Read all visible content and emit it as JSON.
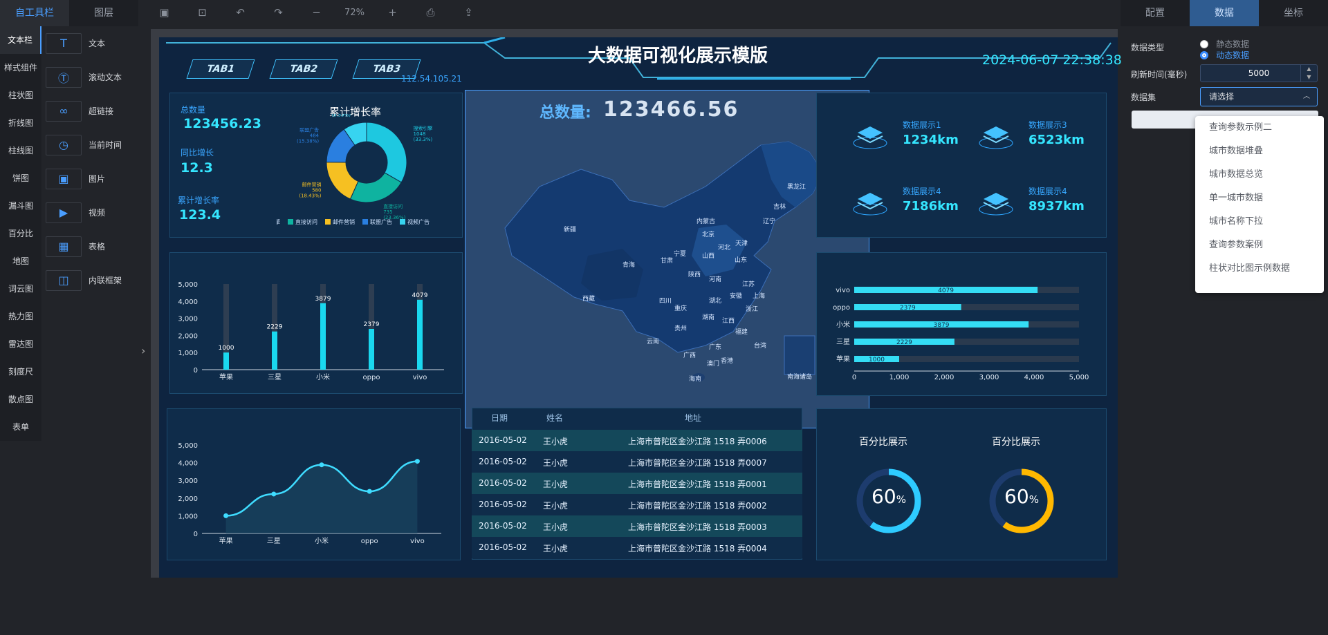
{
  "left_panel": {
    "tabs": [
      "自工具栏",
      "图层"
    ],
    "categories": [
      "文本栏",
      "样式组件",
      "柱状图",
      "折线图",
      "柱线图",
      "饼图",
      "漏斗图",
      "百分比",
      "地图",
      "词云图",
      "热力图",
      "雷达图",
      "刻度尺",
      "散点图",
      "表单"
    ],
    "components": [
      {
        "icon": "text-icon",
        "label": "文本"
      },
      {
        "icon": "scroll-text-icon",
        "label": "滚动文本"
      },
      {
        "icon": "link-icon",
        "label": "超链接"
      },
      {
        "icon": "clock-icon",
        "label": "当前时间"
      },
      {
        "icon": "image-icon",
        "label": "图片"
      },
      {
        "icon": "video-icon",
        "label": "视频"
      },
      {
        "icon": "table-icon",
        "label": "表格"
      },
      {
        "icon": "iframe-icon",
        "label": "内联框架"
      }
    ]
  },
  "toolbar": {
    "zoom": "72%"
  },
  "right_panel": {
    "tabs": [
      "配置",
      "数据",
      "坐标"
    ],
    "data_type_label": "数据类型",
    "data_type_options": [
      "静态数据",
      "动态数据"
    ],
    "refresh_label": "刷新时间(毫秒)",
    "refresh_value": "5000",
    "dataset_label": "数据集",
    "dataset_placeholder": "请选择",
    "dataset_options": [
      "查询参数示例二",
      "城市数据堆叠",
      "城市数据总览",
      "单一城市数据",
      "城市名称下拉",
      "查询参数案例",
      "柱状对比图示例数据"
    ]
  },
  "dashboard": {
    "title": "大数据可视化展示模版",
    "tabs": [
      "TAB1",
      "TAB2",
      "TAB3"
    ],
    "datetime": "2024-06-07 22:38:38",
    "ip": "112.54.105.21",
    "kpis": [
      {
        "label": "总数量",
        "value": "123456.23"
      },
      {
        "label": "同比增长",
        "value": "12.3"
      },
      {
        "label": "累计增长率",
        "value": "123.4"
      }
    ],
    "total_label": "总数量:",
    "total_value": "123466.56",
    "shows": [
      {
        "label": "数据展示1",
        "value": "1234km"
      },
      {
        "label": "数据展示3",
        "value": "6523km"
      },
      {
        "label": "数据展示4",
        "value": "7186km"
      },
      {
        "label": "数据展示4",
        "value": "8937km"
      }
    ],
    "table": {
      "headers": [
        "日期",
        "姓名",
        "地址"
      ],
      "rows": [
        [
          "2016-05-02",
          "王小虎",
          "上海市普陀区金沙江路 1518 弄0006"
        ],
        [
          "2016-05-02",
          "王小虎",
          "上海市普陀区金沙江路 1518 弄0007"
        ],
        [
          "2016-05-02",
          "王小虎",
          "上海市普陀区金沙江路 1518 弄0001"
        ],
        [
          "2016-05-02",
          "王小虎",
          "上海市普陀区金沙江路 1518 弄0002"
        ],
        [
          "2016-05-02",
          "王小虎",
          "上海市普陀区金沙江路 1518 弄0003"
        ],
        [
          "2016-05-02",
          "王小虎",
          "上海市普陀区金沙江路 1518 弄0004"
        ]
      ]
    },
    "gauges": [
      {
        "title": "百分比展示",
        "value": "60",
        "unit": "%",
        "color": "#2ecbff"
      },
      {
        "title": "百分比展示",
        "value": "60",
        "unit": "%",
        "color": "#ffb800"
      }
    ],
    "map_labels": [
      "新疆",
      "西藏",
      "青海",
      "甘肃",
      "宁夏",
      "内蒙古",
      "黑龙江",
      "吉林",
      "辽宁",
      "北京",
      "天津",
      "河北",
      "山西",
      "山东",
      "陕西",
      "河南",
      "江苏",
      "四川",
      "湖北",
      "安徽",
      "上海",
      "重庆",
      "湖南",
      "江西",
      "浙江",
      "贵州",
      "福建",
      "云南",
      "广西",
      "广东",
      "台湾",
      "澳门",
      "香港",
      "海南",
      "南海诸岛"
    ]
  },
  "chart_data": [
    {
      "type": "pie",
      "title": "累计增长率",
      "categories": [
        "搜索引擎",
        "直接访问",
        "邮件营销",
        "联盟广告",
        "视频广告"
      ],
      "values": [
        1048,
        735,
        580,
        484,
        300
      ],
      "percents": [
        "33.3%",
        "23.36%",
        "18.43%",
        "15.38%",
        "9.53%"
      ],
      "colors": [
        "#1ec8e0",
        "#0fb3a0",
        "#f6c022",
        "#2a7fe0",
        "#37d4f0"
      ]
    },
    {
      "type": "bar",
      "categories": [
        "苹果",
        "三星",
        "小米",
        "oppo",
        "vivo"
      ],
      "values": [
        1000,
        2229,
        3879,
        2379,
        4079
      ],
      "ylim": [
        0,
        5000
      ],
      "yticks": [
        "0",
        "1,000",
        "2,000",
        "3,000",
        "4,000",
        "5,000"
      ]
    },
    {
      "type": "area",
      "categories": [
        "苹果",
        "三星",
        "小米",
        "oppo",
        "vivo"
      ],
      "values": [
        1000,
        2229,
        3879,
        2379,
        4079
      ],
      "ylim": [
        0,
        5000
      ],
      "yticks": [
        "0",
        "1,000",
        "2,000",
        "3,000",
        "4,000",
        "5,000"
      ]
    },
    {
      "type": "bar",
      "orientation": "horizontal",
      "categories": [
        "vivo",
        "oppo",
        "小米",
        "三星",
        "苹果"
      ],
      "values": [
        4079,
        2379,
        3879,
        2229,
        1000
      ],
      "xlim": [
        0,
        5000
      ],
      "xticks": [
        "0",
        "1,000",
        "2,000",
        "3,000",
        "4,000",
        "5,000"
      ]
    }
  ]
}
